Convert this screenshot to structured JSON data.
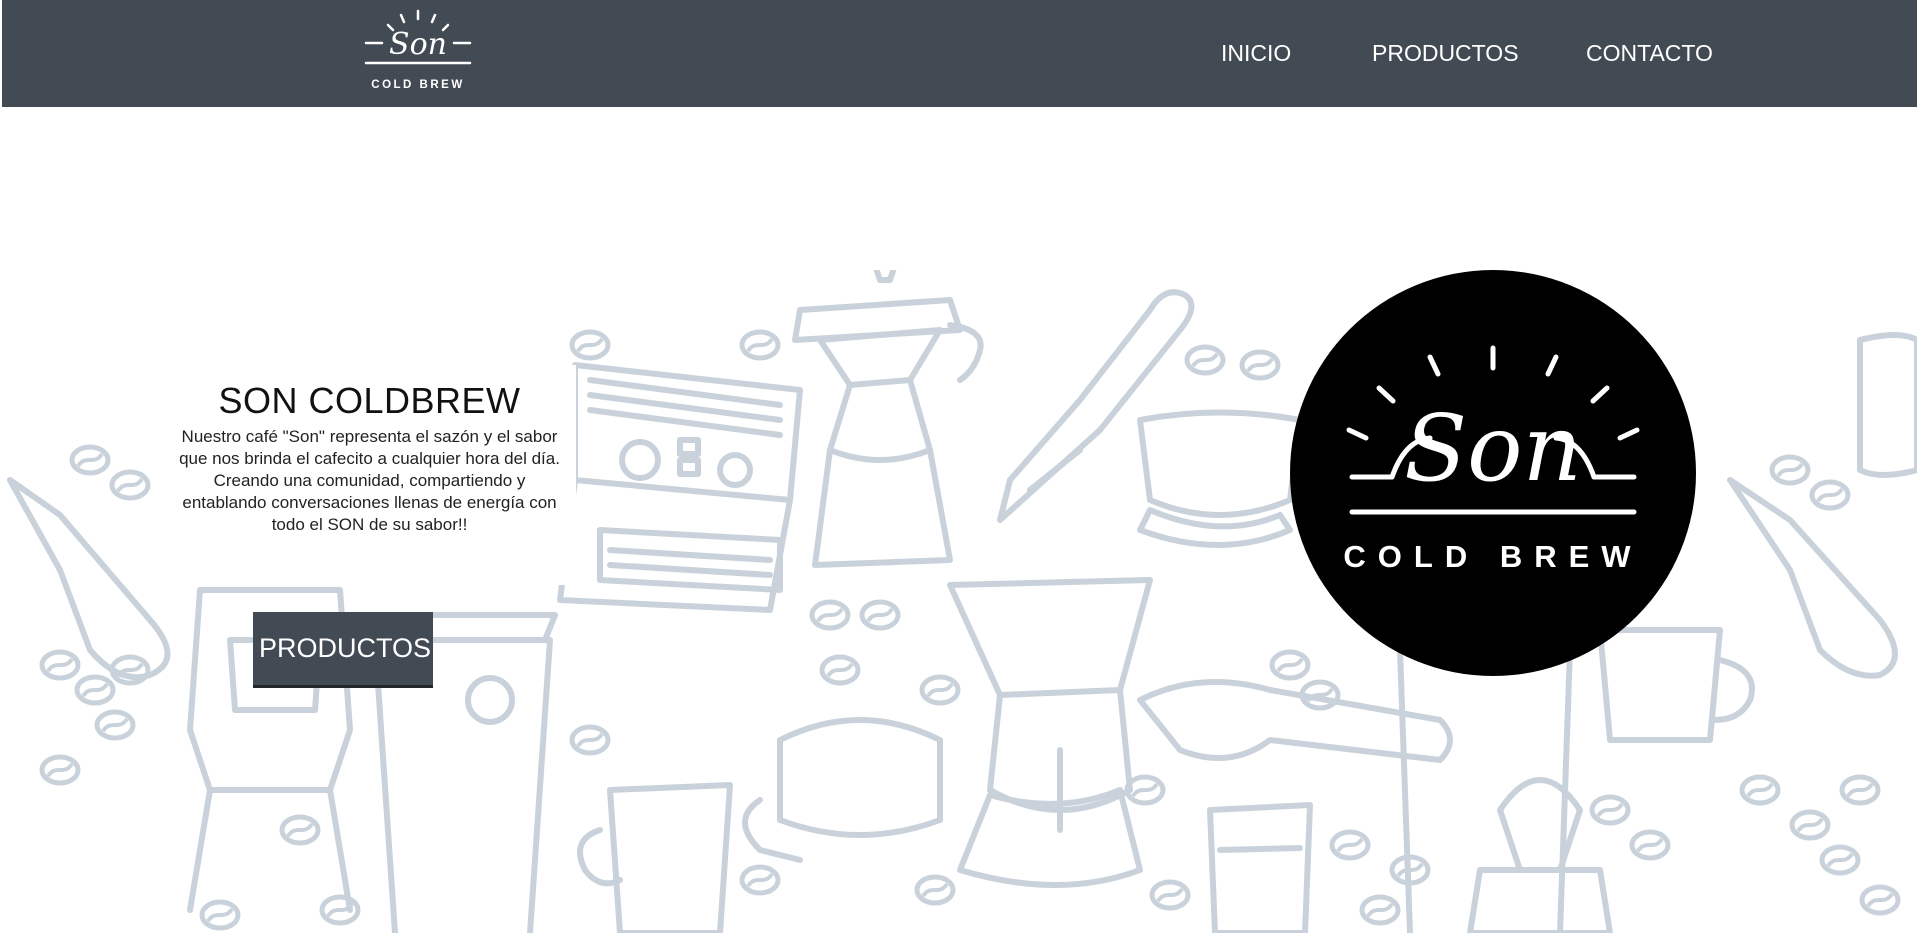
{
  "brand": {
    "logo_script": "Son",
    "logo_sub": "COLD BREW"
  },
  "nav": {
    "items": [
      {
        "label": "INICIO"
      },
      {
        "label": "PRODUCTOS"
      },
      {
        "label": "CONTACTO"
      }
    ]
  },
  "hero": {
    "title": "SON COLDBREW",
    "description": "Nuestro café \"Son\" representa el sazón y el sabor que nos brinda el cafecito a cualquier hora del día. Creando una comunidad, compartiendo y entablando conversaciones llenas de energía con todo el SON de su sabor!!",
    "button_label": "PRODUCTOS"
  },
  "colors": {
    "navbar": "#424a53",
    "button": "#424a53",
    "illustration": "#c9d2db",
    "badge": "#000000"
  }
}
